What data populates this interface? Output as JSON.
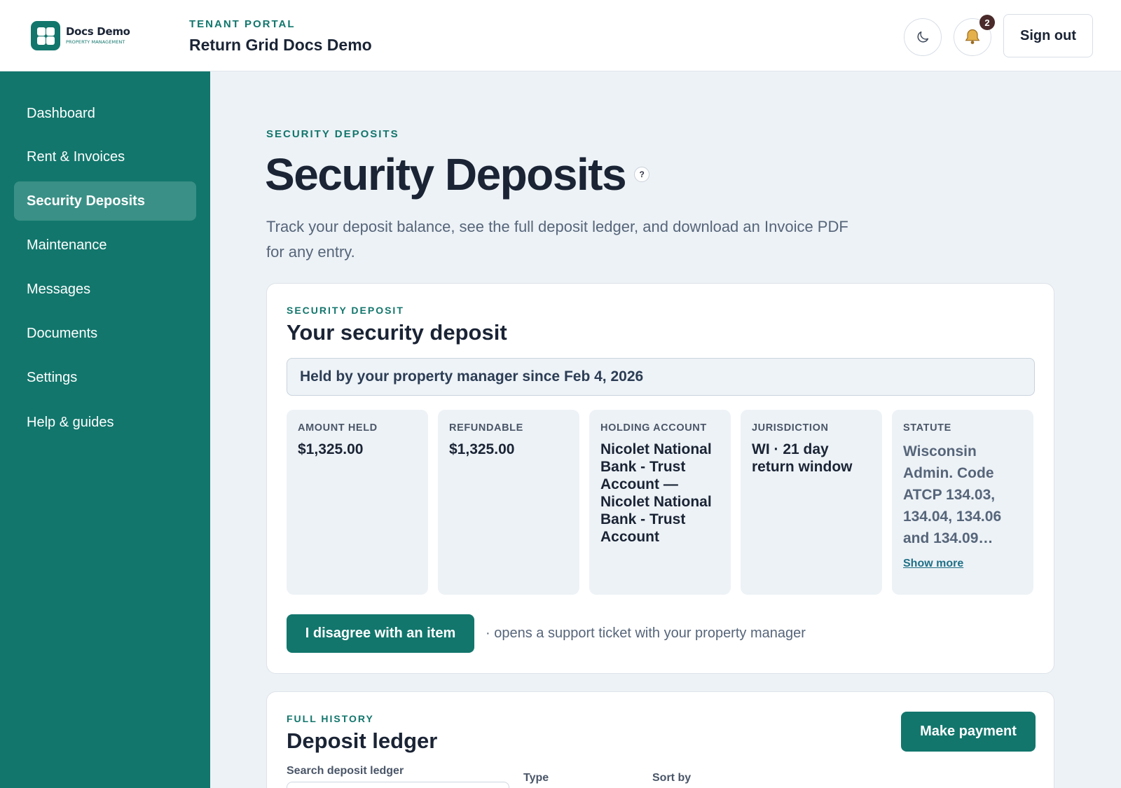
{
  "header": {
    "logo_name": "Docs Demo",
    "logo_sub": "PROPERTY MANAGEMENT",
    "eyebrow": "TENANT PORTAL",
    "title": "Return Grid Docs Demo",
    "notifications_count": "2",
    "sign_out_label": "Sign out"
  },
  "sidebar": {
    "items": [
      {
        "label": "Dashboard"
      },
      {
        "label": "Rent & Invoices"
      },
      {
        "label": "Security Deposits",
        "active": true
      },
      {
        "label": "Maintenance"
      },
      {
        "label": "Messages"
      },
      {
        "label": "Documents"
      },
      {
        "label": "Settings"
      },
      {
        "label": "Help & guides"
      }
    ]
  },
  "page": {
    "eyebrow": "SECURITY DEPOSITS",
    "title": "Security Deposits",
    "help_glyph": "?",
    "description": "Track your deposit balance, see the full deposit ledger, and download an Invoice PDF for any entry."
  },
  "deposit_card": {
    "eyebrow": "SECURITY DEPOSIT",
    "title": "Your security deposit",
    "held_banner": "Held by your property manager since Feb 4, 2026",
    "stats": [
      {
        "label": "AMOUNT HELD",
        "value": "$1,325.00"
      },
      {
        "label": "REFUNDABLE",
        "value": "$1,325.00"
      },
      {
        "label": "HOLDING ACCOUNT",
        "value": "Nicolet National Bank - Trust Account — Nicolet National Bank - Trust Account"
      },
      {
        "label": "JURISDICTION",
        "value": "WI · 21 day return window"
      },
      {
        "label": "STATUTE",
        "value": "Wisconsin Admin. Code ATCP 134.03, 134.04, 134.06 and 134.09…",
        "link": "Show more"
      }
    ],
    "disagree_label": "I disagree with an item",
    "disagree_note": "· opens a support ticket with your property manager"
  },
  "ledger_card": {
    "eyebrow": "FULL HISTORY",
    "title": "Deposit ledger",
    "make_payment_label": "Make payment",
    "search_label": "Search deposit ledger",
    "search_value": "",
    "type_label": "Type",
    "sort_label": "Sort by"
  },
  "colors": {
    "brand": "#12766c",
    "sidebar_active": "#3a9086",
    "page_bg": "#edf2f6"
  }
}
